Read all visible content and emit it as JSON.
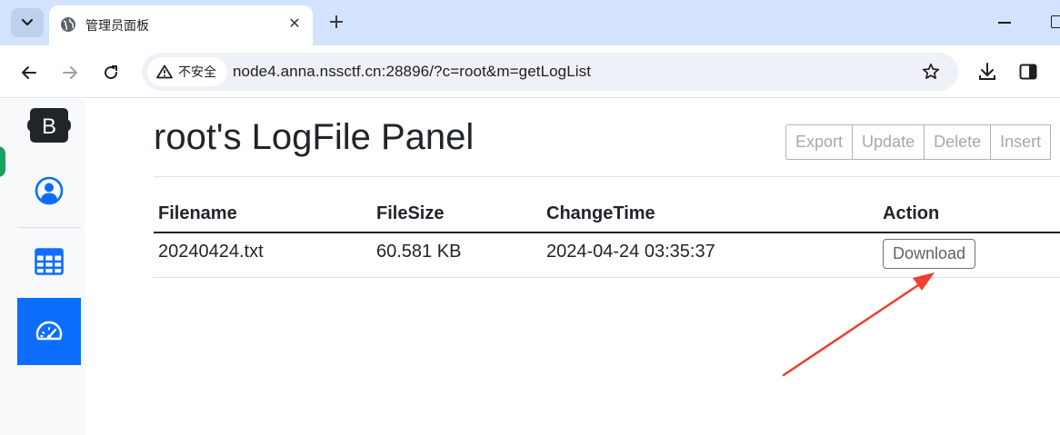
{
  "browser": {
    "tab_title": "管理员面板",
    "security_label": "不安全",
    "url": "node4.anna.nssctf.cn:28896/?c=root&m=getLogList"
  },
  "page": {
    "title": "root's LogFile Panel",
    "buttons": [
      "Export",
      "Update",
      "Delete",
      "Insert"
    ],
    "table": {
      "headers": [
        "Filename",
        "FileSize",
        "ChangeTime",
        "Action"
      ],
      "rows": [
        {
          "filename": "20240424.txt",
          "filesize": "60.581 KB",
          "changetime": "2024-04-24 03:35:37",
          "action": "Download"
        }
      ]
    }
  },
  "colors": {
    "accent": "#0d6efd",
    "annotation_arrow": "#f23d2f"
  },
  "sidebar": {
    "items": [
      "bootstrap-logo",
      "user-icon",
      "table-icon",
      "speedometer-icon"
    ],
    "active_item": "speedometer-icon"
  }
}
